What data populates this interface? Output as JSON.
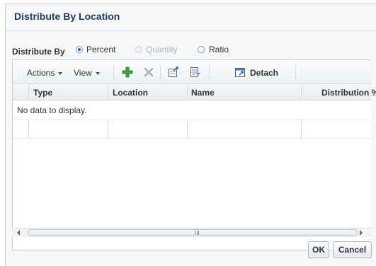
{
  "dialog": {
    "title": "Distribute By Location"
  },
  "distribute_by": {
    "label": "Distribute By",
    "options": [
      {
        "label": "Percent",
        "checked": true,
        "disabled": false
      },
      {
        "label": "Quantity",
        "checked": false,
        "disabled": true
      },
      {
        "label": "Ratio",
        "checked": false,
        "disabled": false
      }
    ]
  },
  "toolbar": {
    "actions_label": "Actions",
    "view_label": "View",
    "detach_label": "Detach",
    "icons": [
      "add-icon",
      "delete-icon",
      "export-icon",
      "edit-icon",
      "detach-icon"
    ],
    "add_color": "#3aa935"
  },
  "table": {
    "columns": [
      "Type",
      "Location",
      "Name",
      "Distribution %"
    ],
    "empty_message": "No data to display."
  },
  "scrollbar": {
    "grip": "III"
  },
  "buttons": {
    "ok": "OK",
    "cancel": "Cancel"
  }
}
